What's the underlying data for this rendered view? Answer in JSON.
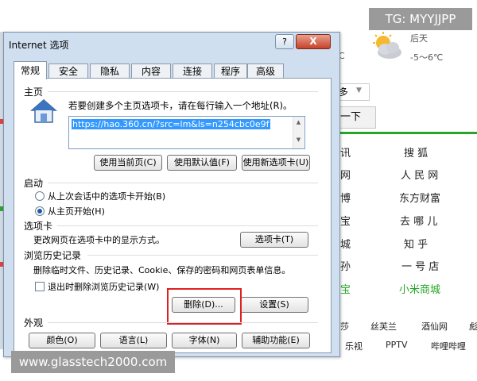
{
  "watermark_top": "TG: MYYJJPP",
  "watermark_bottom": "www.glasstech2000.com",
  "background": {
    "weather": {
      "condition": "后天",
      "temp": "-5～6℃",
      "unit_c": "C"
    },
    "search_suffix": "多",
    "search_button": "一下",
    "sites": [
      [
        "讯",
        "搜 狐"
      ],
      [
        "网",
        "人 民 网"
      ],
      [
        "博",
        "东方财富"
      ],
      [
        "宝",
        "去 哪 儿"
      ],
      [
        "城",
        "知 乎"
      ],
      [
        "孙",
        "一 号 店"
      ],
      [
        "宝",
        "小米商城"
      ]
    ],
    "bottom_row1": [
      "莎",
      "丝芙兰",
      "酒仙网",
      "彪"
    ],
    "bottom_row2": [
      "乐视",
      "PPTV",
      "哔哩哔哩"
    ]
  },
  "dialog": {
    "title": "Internet 选项",
    "help": "?",
    "close": "X",
    "tabs": [
      "常规",
      "安全",
      "隐私",
      "内容",
      "连接",
      "程序",
      "高级"
    ],
    "home": {
      "label": "主页",
      "description": "若要创建多个主页选项卡，请在每行输入一个地址(R)。",
      "url": "https://hao.360.cn/?src=lm&ls=n254cbc0e9f",
      "btn_current": "使用当前页(C)",
      "btn_default": "使用默认值(F)",
      "btn_newtab": "使用新选项卡(U)"
    },
    "startup": {
      "label": "启动",
      "option1": "从上次会话中的选项卡开始(B)",
      "option2": "从主页开始(H)"
    },
    "tabs_section": {
      "label": "选项卡",
      "description": "更改网页在选项卡中的显示方式。",
      "button": "选项卡(T)"
    },
    "history": {
      "label": "浏览历史记录",
      "description": "删除临时文件、历史记录、Cookie、保存的密码和网页表单信息。",
      "checkbox": "退出时删除浏览历史记录(W)",
      "btn_delete": "删除(D)...",
      "btn_settings": "设置(S)"
    },
    "appearance": {
      "label": "外观",
      "btn_colors": "颜色(O)",
      "btn_languages": "语言(L)",
      "btn_fonts": "字体(N)",
      "btn_accessibility": "辅助功能(E)"
    }
  },
  "colors": {
    "dialog_frame": "#cfdff0",
    "accent_green": "#27a527",
    "highlight_red": "#e02020",
    "selection_blue": "#3399ff"
  }
}
